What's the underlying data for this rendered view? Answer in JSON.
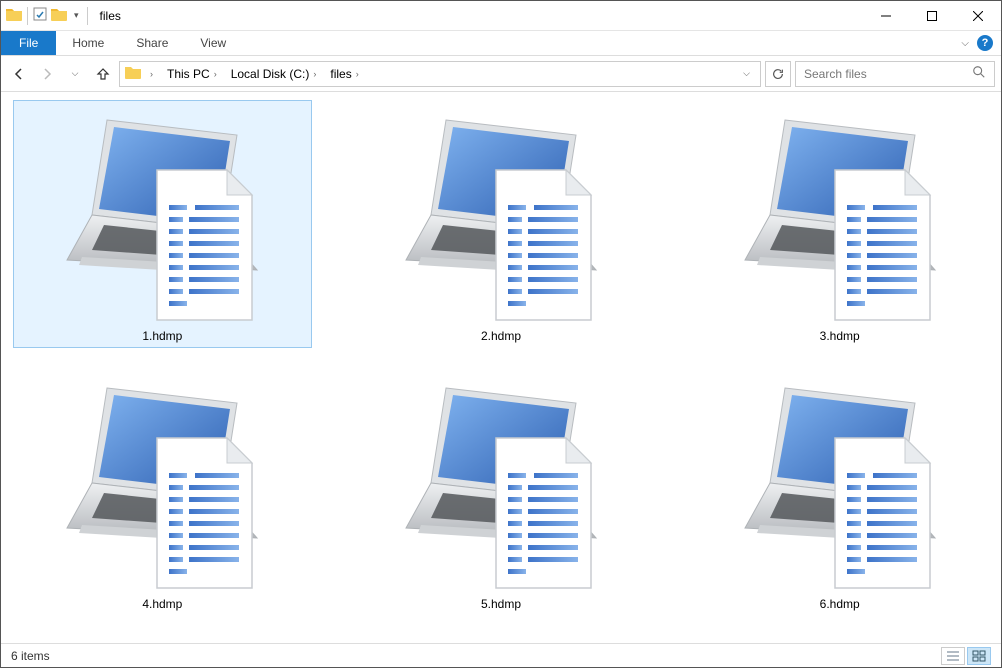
{
  "window": {
    "title": "files"
  },
  "ribbon": {
    "file": "File",
    "tabs": [
      "Home",
      "Share",
      "View"
    ]
  },
  "breadcrumb": {
    "segments": [
      "This PC",
      "Local Disk (C:)",
      "files"
    ]
  },
  "search": {
    "placeholder": "Search files"
  },
  "files": [
    {
      "name": "1.hdmp",
      "selected": true
    },
    {
      "name": "2.hdmp",
      "selected": false
    },
    {
      "name": "3.hdmp",
      "selected": false
    },
    {
      "name": "4.hdmp",
      "selected": false
    },
    {
      "name": "5.hdmp",
      "selected": false
    },
    {
      "name": "6.hdmp",
      "selected": false
    }
  ],
  "status": {
    "count_text": "6 items"
  }
}
